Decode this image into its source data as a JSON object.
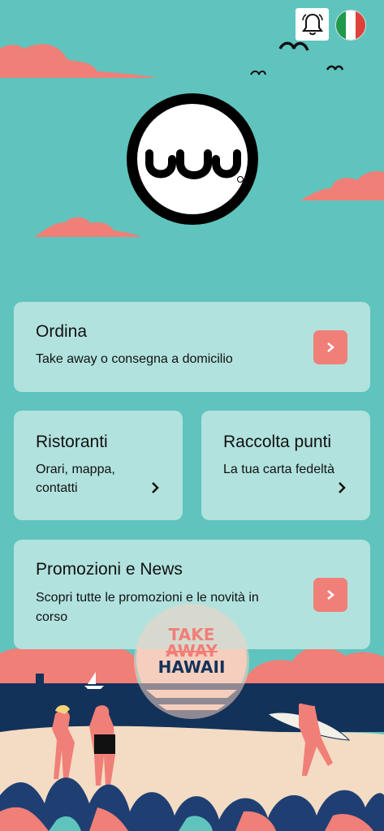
{
  "header": {
    "notifications_icon": "bell-icon",
    "language_icon": "italian-flag-icon",
    "flag_colors": [
      "#1e9a4a",
      "#ffffff",
      "#e0403a"
    ]
  },
  "logo": {
    "icon": "brand-logo-icon"
  },
  "cards": {
    "ordina": {
      "title": "Ordina",
      "subtitle": "Take away o consegna a domicilio"
    },
    "ristoranti": {
      "title": "Ristoranti",
      "subtitle_line1": "Orari, mappa,",
      "subtitle_line2": "contatti"
    },
    "raccolta": {
      "title": "Raccolta punti",
      "subtitle": "La tua carta fedeltà"
    },
    "promozioni": {
      "title": "Promozioni e News",
      "subtitle_line1": "Scopri tutte le promozioni e le novità in",
      "subtitle_line2": "corso"
    }
  },
  "footer_logo": {
    "line1": "TAKE",
    "line2": "AWAY",
    "line3": "HAWAII"
  },
  "colors": {
    "background": "#5fc4bd",
    "card": "#b1e2de",
    "accent": "#f07f78",
    "sea": "#13325a",
    "sand": "#f3dcc3"
  }
}
